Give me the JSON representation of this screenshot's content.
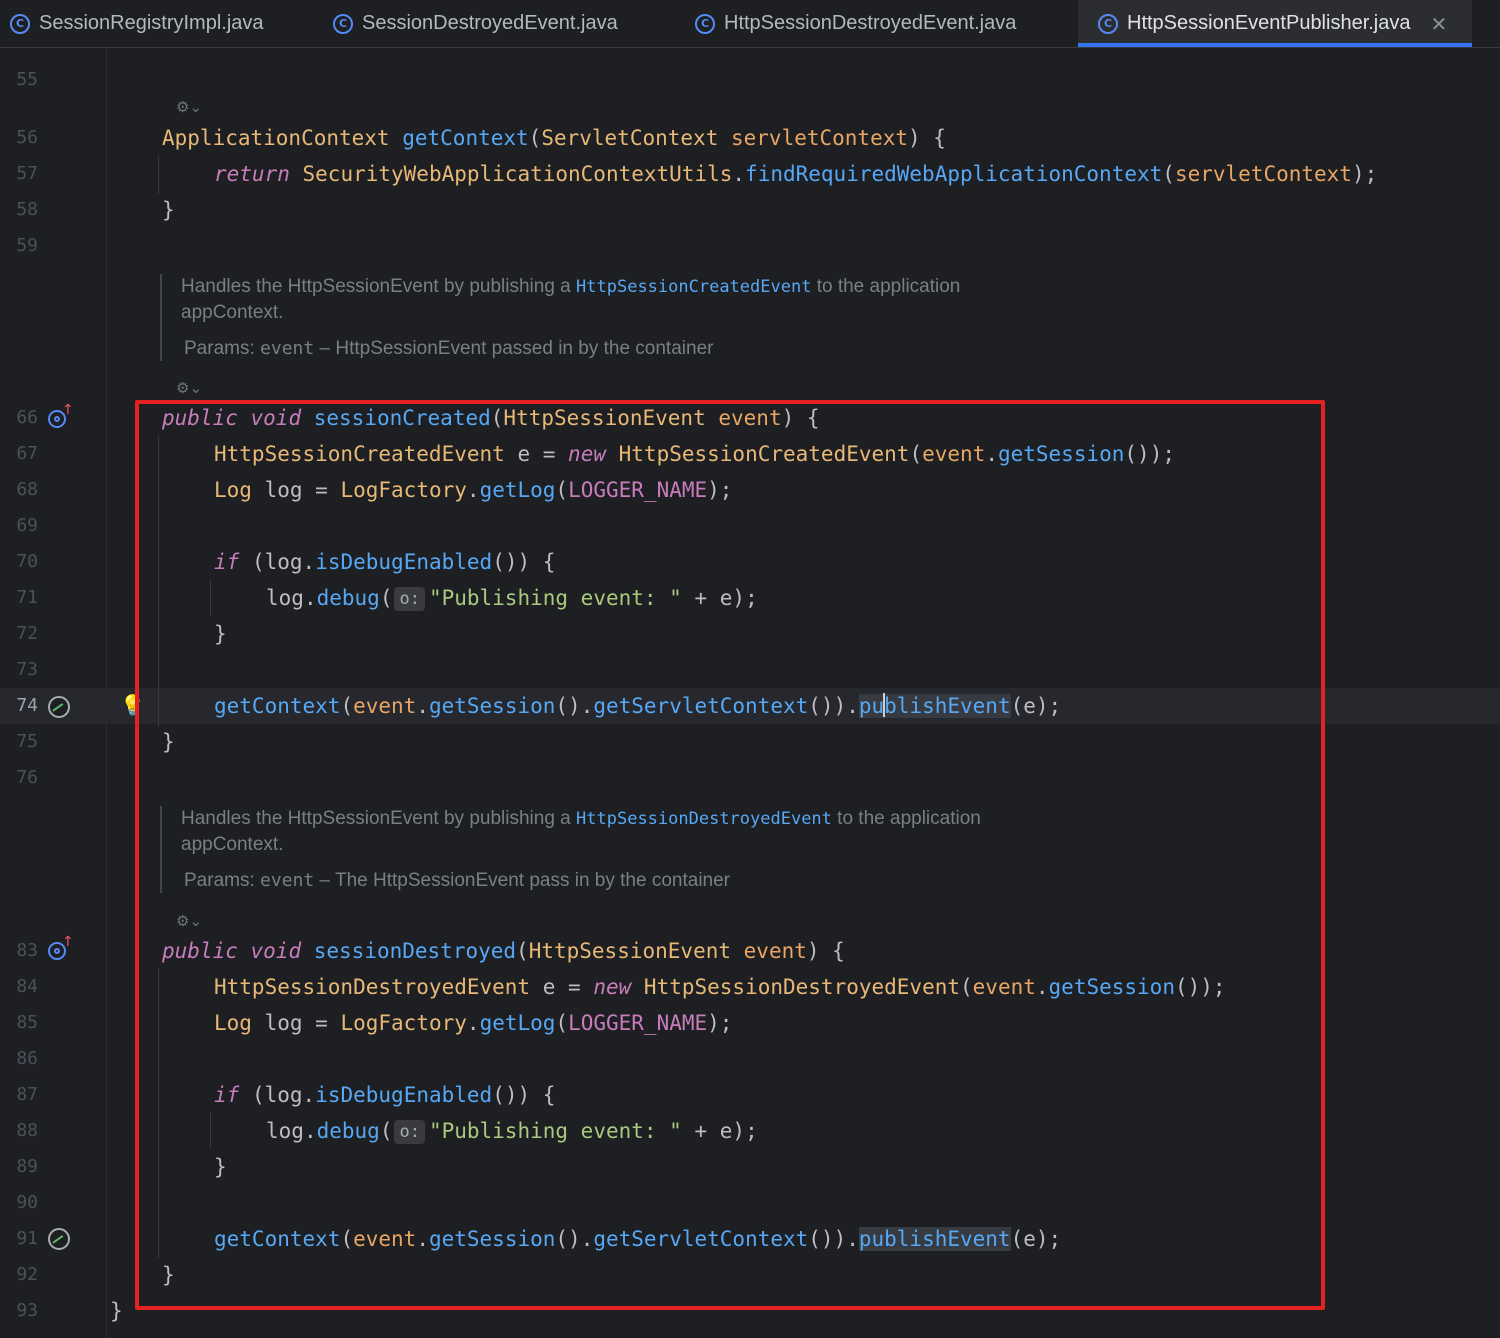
{
  "tabs": [
    {
      "label": "SessionRegistryImpl.java",
      "icon": "class-icon",
      "active": false
    },
    {
      "label": "SessionDestroyedEvent.java",
      "icon": "class-icon",
      "active": false
    },
    {
      "label": "HttpSessionDestroyedEvent.java",
      "icon": "class-icon",
      "active": false
    },
    {
      "label": "HttpSessionEventPublisher.java",
      "icon": "class-icon",
      "active": true
    }
  ],
  "tab_close_glyph": "✕",
  "line_numbers": {
    "l55": "55",
    "l56": "56",
    "l57": "57",
    "l58": "58",
    "l59": "59",
    "l66": "66",
    "l67": "67",
    "l68": "68",
    "l69": "69",
    "l70": "70",
    "l71": "71",
    "l72": "72",
    "l73": "73",
    "l74": "74",
    "l75": "75",
    "l76": "76",
    "l83": "83",
    "l84": "84",
    "l85": "85",
    "l86": "86",
    "l87": "87",
    "l88": "88",
    "l89": "89",
    "l90": "90",
    "l91": "91",
    "l92": "92",
    "l93": "93"
  },
  "tokens": {
    "ApplicationContext": "ApplicationContext",
    "getContext": "getContext",
    "ServletContext": "ServletContext",
    "servletContext": "servletContext",
    "return": "return",
    "SecurityWebApplicationContextUtils": "SecurityWebApplicationContextUtils",
    "findRequiredWebApplicationContext": "findRequiredWebApplicationContext",
    "public": "public",
    "void": "void",
    "sessionCreated": "sessionCreated",
    "sessionDestroyed": "sessionDestroyed",
    "HttpSessionEvent": "HttpSessionEvent",
    "event": "event",
    "HttpSessionCreatedEvent": "HttpSessionCreatedEvent",
    "HttpSessionDestroyedEvent": "HttpSessionDestroyedEvent",
    "e": "e",
    "new": "new",
    "getSession": "getSession",
    "Log": "Log",
    "log": "log",
    "LogFactory": "LogFactory",
    "getLog": "getLog",
    "LOGGER_NAME": "LOGGER_NAME",
    "if": "if",
    "isDebugEnabled": "isDebugEnabled",
    "debug": "debug",
    "hint_o": "o:",
    "publishing_string": "\"Publishing event: \"",
    "getServletContext": "getServletContext",
    "publishEvent_pu": "pu",
    "publishEvent_rest": "blishEvent",
    "publishEvent": "publishEvent"
  },
  "docs": {
    "created": {
      "line1_pre": "Handles the HttpSessionEvent by publishing a ",
      "line1_code": "HttpSessionCreatedEvent",
      "line1_post": " to the application",
      "line2": "appContext.",
      "params_label": "Params:",
      "params_name": "event",
      "params_desc": " – HttpSessionEvent passed in by the container"
    },
    "destroyed": {
      "line1_pre": "Handles the HttpSessionEvent by publishing a ",
      "line1_code": "HttpSessionDestroyedEvent",
      "line1_post": " to the application",
      "line2": "appContext.",
      "params_label": "Params:",
      "params_name": "event",
      "params_desc": " – The HttpSessionEvent pass in by the container"
    }
  },
  "colors": {
    "highlight_box": "#e52222",
    "accent": "#3574f0"
  }
}
